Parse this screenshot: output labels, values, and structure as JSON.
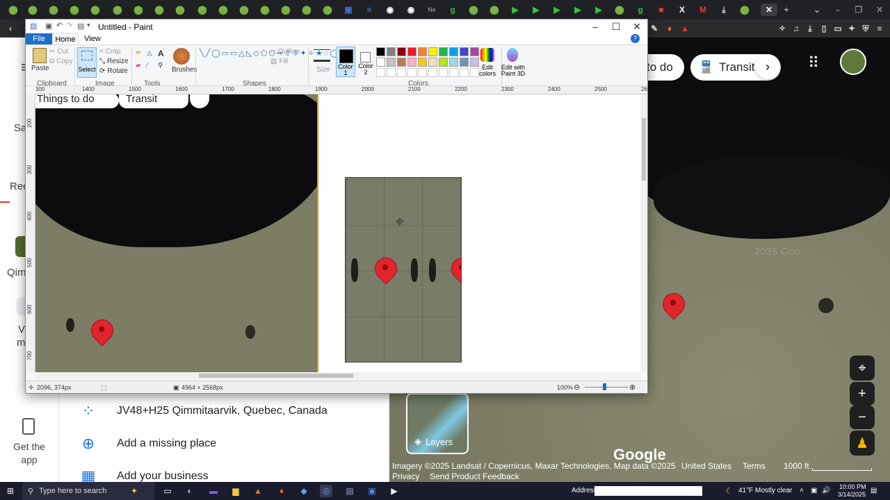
{
  "browser": {
    "close_tab_glyph": "✕",
    "new_tab_glyph": "+"
  },
  "gmaps": {
    "left_rail": {
      "saved_label": "Sa",
      "recents_label": "Rec",
      "place_label": "Qim",
      "v_label": "V",
      "m_label": "m",
      "get_app_label": "Get the app"
    },
    "pills": {
      "things_to_do": "to do",
      "transit": "Transit"
    },
    "plus_code": "JV48+H25 Qimmitaarvik, Quebec, Canada",
    "add_missing_place": "Add a missing place",
    "add_business": "Add your business",
    "layers_label": "Layers",
    "attribution": {
      "imagery": "Imagery ©2025 Landsat / Copernicus, Maxar Technologies, Map data ©2025",
      "country": "United States",
      "terms": "Terms",
      "scale": "1000 ft",
      "privacy": "Privacy",
      "feedback": "Send Product Feedback",
      "google": "Google"
    },
    "watermark": "2025 Goo"
  },
  "paint": {
    "title": "Untitled - Paint",
    "tabs": {
      "file": "File",
      "home": "Home",
      "view": "View"
    },
    "ribbon": {
      "paste": "Paste",
      "cut": "Cut",
      "copy": "Copy",
      "select": "Select",
      "crop": "Crop",
      "resize": "Resize",
      "rotate": "Rotate",
      "brushes": "Brushes",
      "outline": "Outline",
      "fill": "Fill",
      "size": "Size",
      "color1": "Color 1",
      "color2": "Color 2",
      "edit_colors": "Edit colors",
      "edit_paint3d": "Edit with Paint 3D",
      "groups": {
        "clipboard": "Clipboard",
        "image": "Image",
        "tools": "Tools",
        "shapes": "Shapes",
        "colors": "Colors"
      }
    },
    "palette": [
      "#000000",
      "#7f7f7f",
      "#880015",
      "#ed1c24",
      "#ff7f27",
      "#fff200",
      "#22b14c",
      "#00a2e8",
      "#3f48cc",
      "#a349a4",
      "#ffffff",
      "#c3c3c3",
      "#b97a57",
      "#ffaec9",
      "#ffc90e",
      "#efe4b0",
      "#b5e61d",
      "#99d9ea",
      "#7092be",
      "#c8bfe7"
    ],
    "color1": "#000000",
    "color2": "#ffffff",
    "ruler_h": [
      "300",
      "1400",
      "1500",
      "1600",
      "1700",
      "1800",
      "1900",
      "2000",
      "2100",
      "2200",
      "2300",
      "2400",
      "2500",
      "2600"
    ],
    "ruler_v": [
      "200",
      "300",
      "400",
      "500",
      "600",
      "700"
    ],
    "canvas_overlay_text": {
      "things_to_do": "Things to do",
      "transit": "Transit"
    },
    "status": {
      "cursor_pos": "2096, 374px",
      "image_size": "4964 × 2568px",
      "zoom": "100%"
    }
  },
  "taskbar": {
    "search_placeholder": "Type here to search",
    "address_label": "Address",
    "weather": "41°F  Mostly clear",
    "time": "10:00 PM",
    "date": "3/14/2025"
  }
}
